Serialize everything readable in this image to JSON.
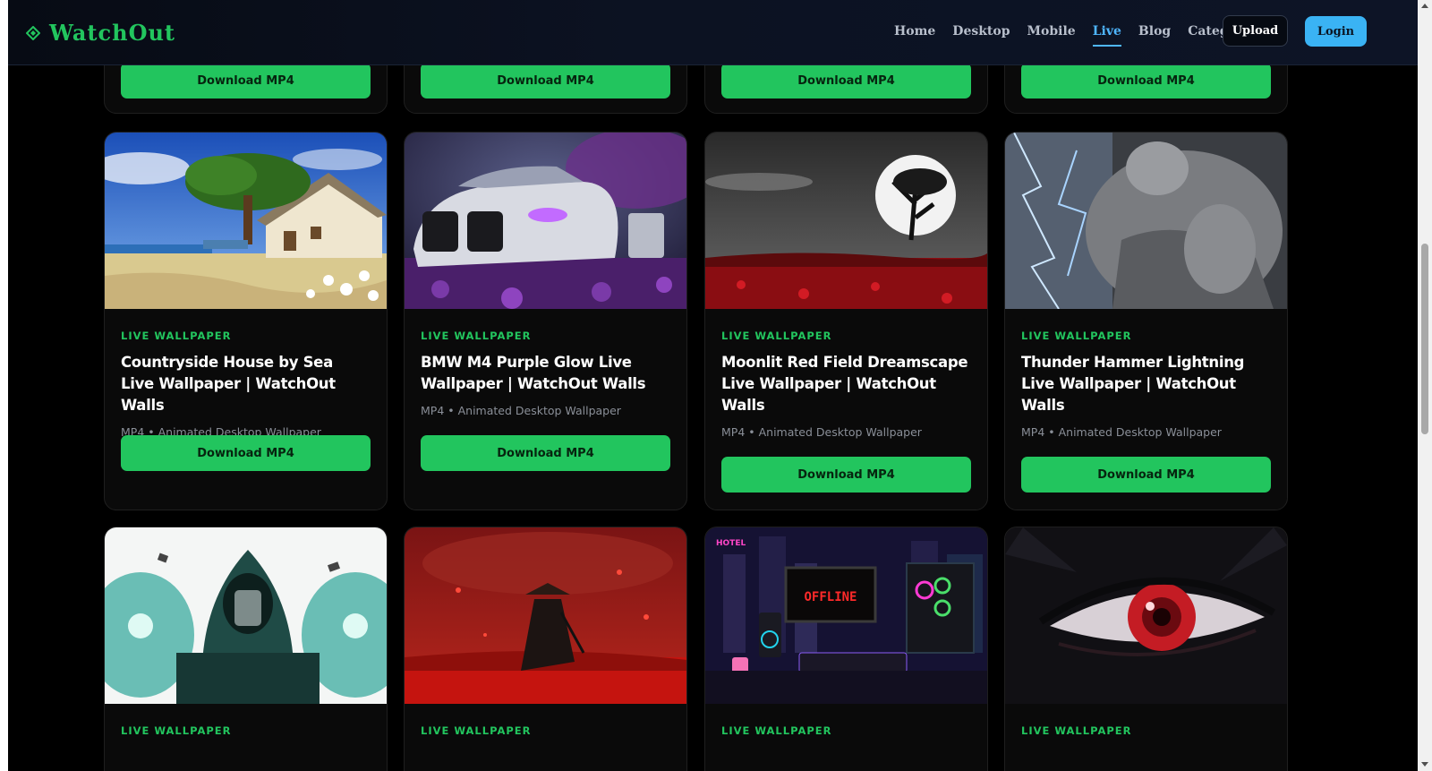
{
  "brand": {
    "name": "WatchOut",
    "color": "#22c55e"
  },
  "nav": {
    "items": [
      {
        "label": "Home",
        "active": false
      },
      {
        "label": "Desktop",
        "active": false
      },
      {
        "label": "Mobile",
        "active": false
      },
      {
        "label": "Live",
        "active": true
      },
      {
        "label": "Blog",
        "active": false
      },
      {
        "label": "Categories",
        "active": false,
        "has_dropdown": true
      }
    ],
    "upload_label": "Upload",
    "login_label": "Login"
  },
  "colors": {
    "accent": "#22c55e",
    "active_nav": "#4fb6ff",
    "login_bg": "#3ab3f4"
  },
  "top_row": {
    "button_labels": [
      "Download MP4",
      "Download MP4",
      "Download MP4",
      "Download MP4"
    ]
  },
  "cards_row2": [
    {
      "label": "LIVE WALLPAPER",
      "title": "Countryside House by Sea Live Wallpaper | WatchOut Walls",
      "meta": "MP4 • Animated Desktop Wallpaper",
      "button": "Download MP4",
      "thumb": "countryside-house-thumbnail"
    },
    {
      "label": "LIVE WALLPAPER",
      "title": "BMW M4 Purple Glow Live Wallpaper | WatchOut Walls",
      "meta": "MP4 • Animated Desktop Wallpaper",
      "button": "Download MP4",
      "thumb": "bmw-m4-thumbnail"
    },
    {
      "label": "LIVE WALLPAPER",
      "title": "Moonlit Red Field Dreamscape Live Wallpaper | WatchOut Walls",
      "meta": "MP4 • Animated Desktop Wallpaper",
      "button": "Download MP4",
      "thumb": "moonlit-field-thumbnail"
    },
    {
      "label": "LIVE WALLPAPER",
      "title": "Thunder Hammer Lightning Live Wallpaper | WatchOut Walls",
      "meta": "MP4 • Animated Desktop Wallpaper",
      "button": "Download MP4",
      "thumb": "thunder-hammer-thumbnail"
    }
  ],
  "cards_row3": [
    {
      "label": "LIVE WALLPAPER",
      "thumb": "hooded-sorcerer-thumbnail",
      "thumb_text": ""
    },
    {
      "label": "LIVE WALLPAPER",
      "thumb": "samurai-red-field-thumbnail",
      "thumb_text": ""
    },
    {
      "label": "LIVE WALLPAPER",
      "thumb": "cyberpunk-room-thumbnail",
      "thumb_text": "OFFLINE",
      "sign_text": "HOTEL"
    },
    {
      "label": "LIVE WALLPAPER",
      "thumb": "red-eye-thumbnail",
      "thumb_text": ""
    }
  ]
}
